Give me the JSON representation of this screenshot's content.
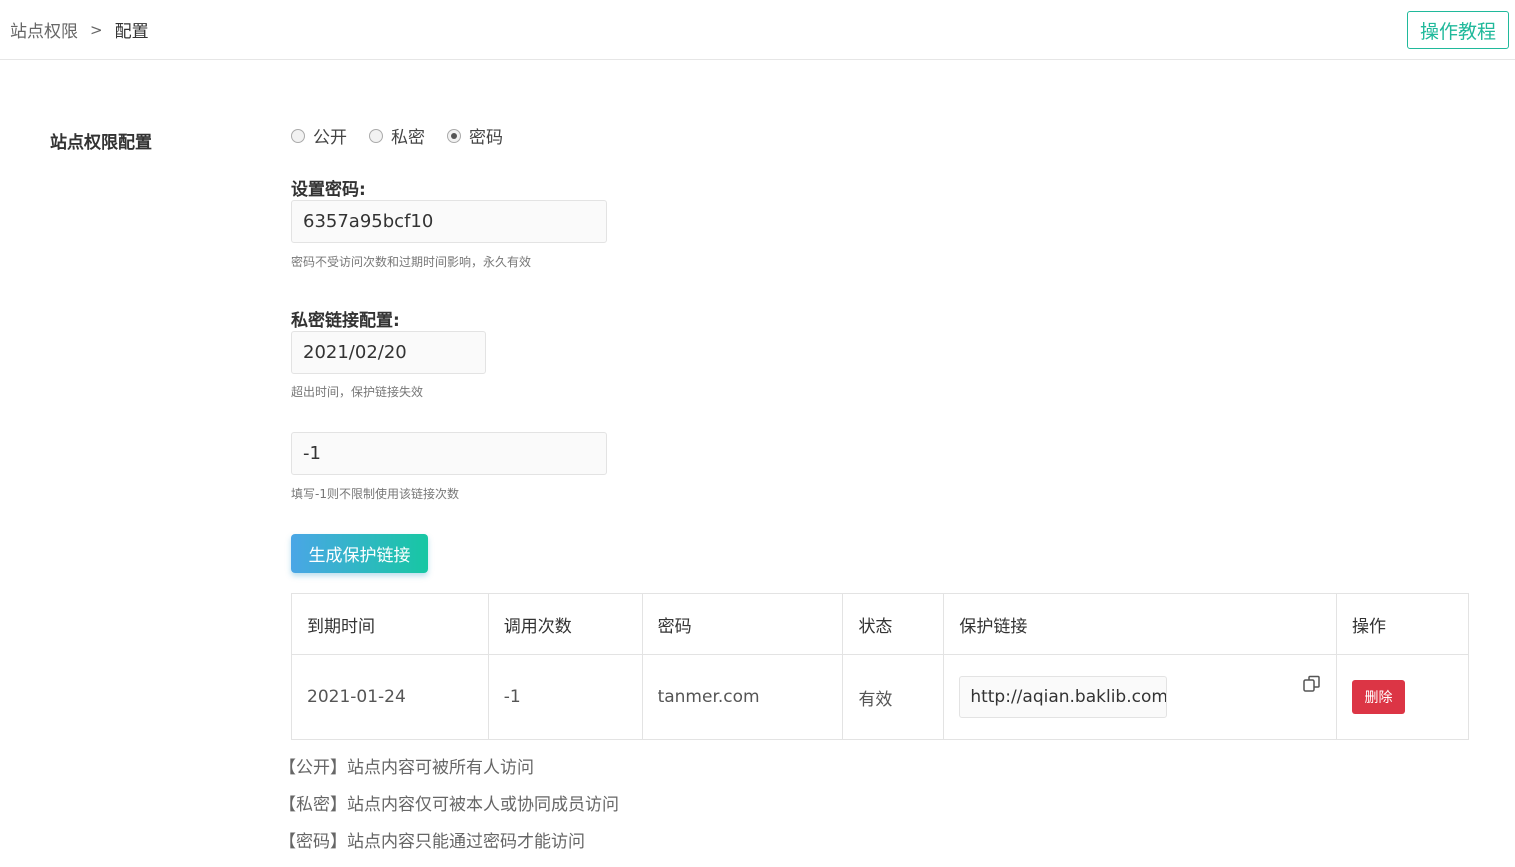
{
  "breadcrumb": {
    "root": "站点权限",
    "separator": ">",
    "current": "配置"
  },
  "tutorial_label": "操作教程",
  "section_label": "站点权限配置",
  "access_options": [
    {
      "label": "公开",
      "checked": false
    },
    {
      "label": "私密",
      "checked": false
    },
    {
      "label": "密码",
      "checked": true
    }
  ],
  "password": {
    "title": "设置密码:",
    "value": "6357a95bcf10",
    "hint": "密码不受访问次数和过期时间影响，永久有效"
  },
  "private_link": {
    "title": "私密链接配置:",
    "date_value": "2021/02/20",
    "date_hint": "超出时间，保护链接失效",
    "count_value": "-1",
    "count_hint": "填写-1则不限制使用该链接次数",
    "generate_label": "生成保护链接"
  },
  "table": {
    "headers": [
      "到期时间",
      "调用次数",
      "密码",
      "状态",
      "保护链接",
      "操作"
    ],
    "rows": [
      {
        "expire": "2021-01-24",
        "count": "-1",
        "password": "tanmer.com",
        "status": "有效",
        "link": "http://aqian.baklib.com",
        "delete_label": "删除"
      }
    ]
  },
  "notes": [
    "【公开】站点内容可被所有人访问",
    "【私密】站点内容仅可被本人或协同成员访问",
    "【密码】站点内容只能通过密码才能访问"
  ],
  "colors": {
    "accent": "#20b99b",
    "danger": "#dc3545",
    "gradient_start": "#4aa6e6",
    "gradient_end": "#17c7a3"
  },
  "icons": {
    "copy": "copy-icon"
  }
}
